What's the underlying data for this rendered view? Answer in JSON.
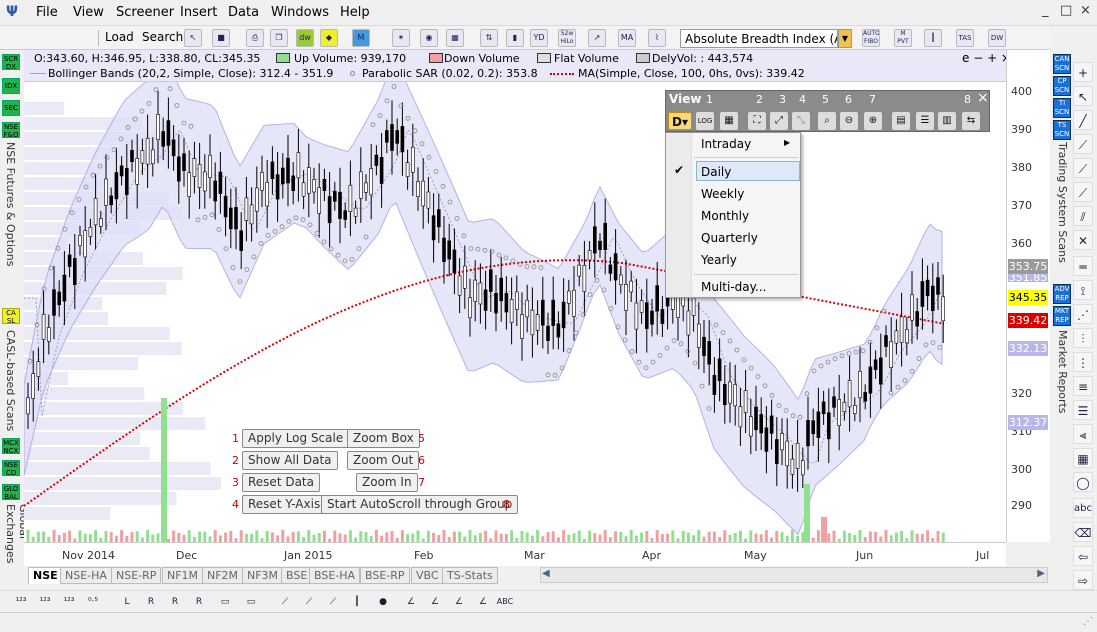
{
  "menu": {
    "items": [
      "File",
      "View",
      "Screener",
      "Insert",
      "Data",
      "Windows",
      "Help"
    ],
    "window_controls": [
      "_",
      "□",
      "×"
    ]
  },
  "toolbar": {
    "load_label": "Load",
    "search_label": "Search",
    "symbol": "Absolute Breadth Index (ABI",
    "icons": [
      "52w HiLo",
      "MA",
      "AUTO FIBO",
      "M PVT",
      "TAS",
      "DW"
    ]
  },
  "legend": {
    "ohlc": "O:343.60, H:346.95, L:338.80, CL:345.35",
    "up_volume": "Up Volume: 939,170",
    "down_volume": "Down Volume",
    "flat_volume": "Flat Volume",
    "dely_vol": "DelyVol: : 443,574",
    "window_ctrls": "e − + ×",
    "bollinger": "Bollinger Bands (20,2, Simple, Close): 312.4 - 351.9",
    "sar": "Parabolic SAR (0.02, 0.2): 353.8",
    "ma": "MA(Simple, Close, 100, 0hs, 0vs): 339.42"
  },
  "left_sidebar": {
    "buttons": [
      "SCR DX",
      "IDX",
      "SEC",
      "NSE F&O",
      "CA SL",
      "MCX NCX",
      "NSE CD",
      "GLO BAL"
    ],
    "labels": [
      "NSE Futures & Options",
      "CASL-based Scans",
      "Global Exchanges"
    ]
  },
  "right_sidebar": {
    "buttons": [
      "CAN SCN",
      "CP SCN",
      "TI SCN",
      "TS SCN",
      "ADV REP",
      "MKT REP"
    ],
    "labels": [
      "Trading System Scans",
      "Market Reports"
    ]
  },
  "price_axis": {
    "ticks": [
      "400",
      "390",
      "380",
      "370",
      "360",
      "320",
      "310",
      "300",
      "290"
    ],
    "badges": [
      {
        "text": "353.75",
        "bg": "#9a9a9a",
        "fg": "#ffffff"
      },
      {
        "text": "351.85",
        "bg": "#b8b8e8",
        "fg": "#ffffff"
      },
      {
        "text": "345.35",
        "bg": "#ffff00",
        "fg": "#000000"
      },
      {
        "text": "339.42",
        "bg": "#dd0000",
        "fg": "#ffffff"
      },
      {
        "text": "332.13",
        "bg": "#b8b8e8",
        "fg": "#ffffff"
      },
      {
        "text": "312.37",
        "bg": "#b8b8e8",
        "fg": "#ffffff"
      }
    ]
  },
  "date_axis": [
    "Nov 2014",
    "Dec",
    "Jan 2015",
    "Feb",
    "Mar",
    "Apr",
    "May",
    "Jun",
    "Jul"
  ],
  "exchange_tabs": [
    "NSE",
    "NSE-HA",
    "NSE-RP",
    "NF1M",
    "NF2M",
    "NF3M",
    "BSE",
    "BSE-HA",
    "BSE-RP",
    "VBC",
    "TS-Stats"
  ],
  "chart_buttons": [
    {
      "num": "1",
      "label": "Apply Log Scale"
    },
    {
      "num": "2",
      "label": "Show All Data"
    },
    {
      "num": "3",
      "label": "Reset Data"
    },
    {
      "num": "4",
      "label": "Reset Y-Axis"
    },
    {
      "num": "5",
      "label": "Zoom Box"
    },
    {
      "num": "6",
      "label": "Zoom Out"
    },
    {
      "num": "7",
      "label": "Zoom In"
    },
    {
      "num": "8",
      "label": "Start AutoScroll through Group"
    }
  ],
  "view_panel": {
    "title": "View",
    "numbers": [
      "1",
      "2",
      "3",
      "4",
      "5",
      "6",
      "7",
      "8"
    ],
    "period_button": "D",
    "log_label": "LOG",
    "close": "×"
  },
  "view_menu": {
    "items": [
      {
        "label": "Intraday",
        "submenu": true,
        "checked": false
      },
      {
        "label": "Daily",
        "submenu": false,
        "checked": true
      },
      {
        "label": "Weekly",
        "submenu": false,
        "checked": false
      },
      {
        "label": "Monthly",
        "submenu": false,
        "checked": false
      },
      {
        "label": "Quarterly",
        "submenu": false,
        "checked": false
      },
      {
        "label": "Yearly",
        "submenu": false,
        "checked": false
      },
      {
        "label": "Multi-day...",
        "submenu": false,
        "checked": false
      }
    ]
  },
  "colors": {
    "up_candle": "#000000",
    "bollinger_fill": "#e0e0f8",
    "bollinger_line": "#a0a0e0",
    "ma_line": "#dd0000",
    "sar_dots": "#888888",
    "volume_up": "#90e090",
    "volume_down": "#f0a0a0"
  }
}
